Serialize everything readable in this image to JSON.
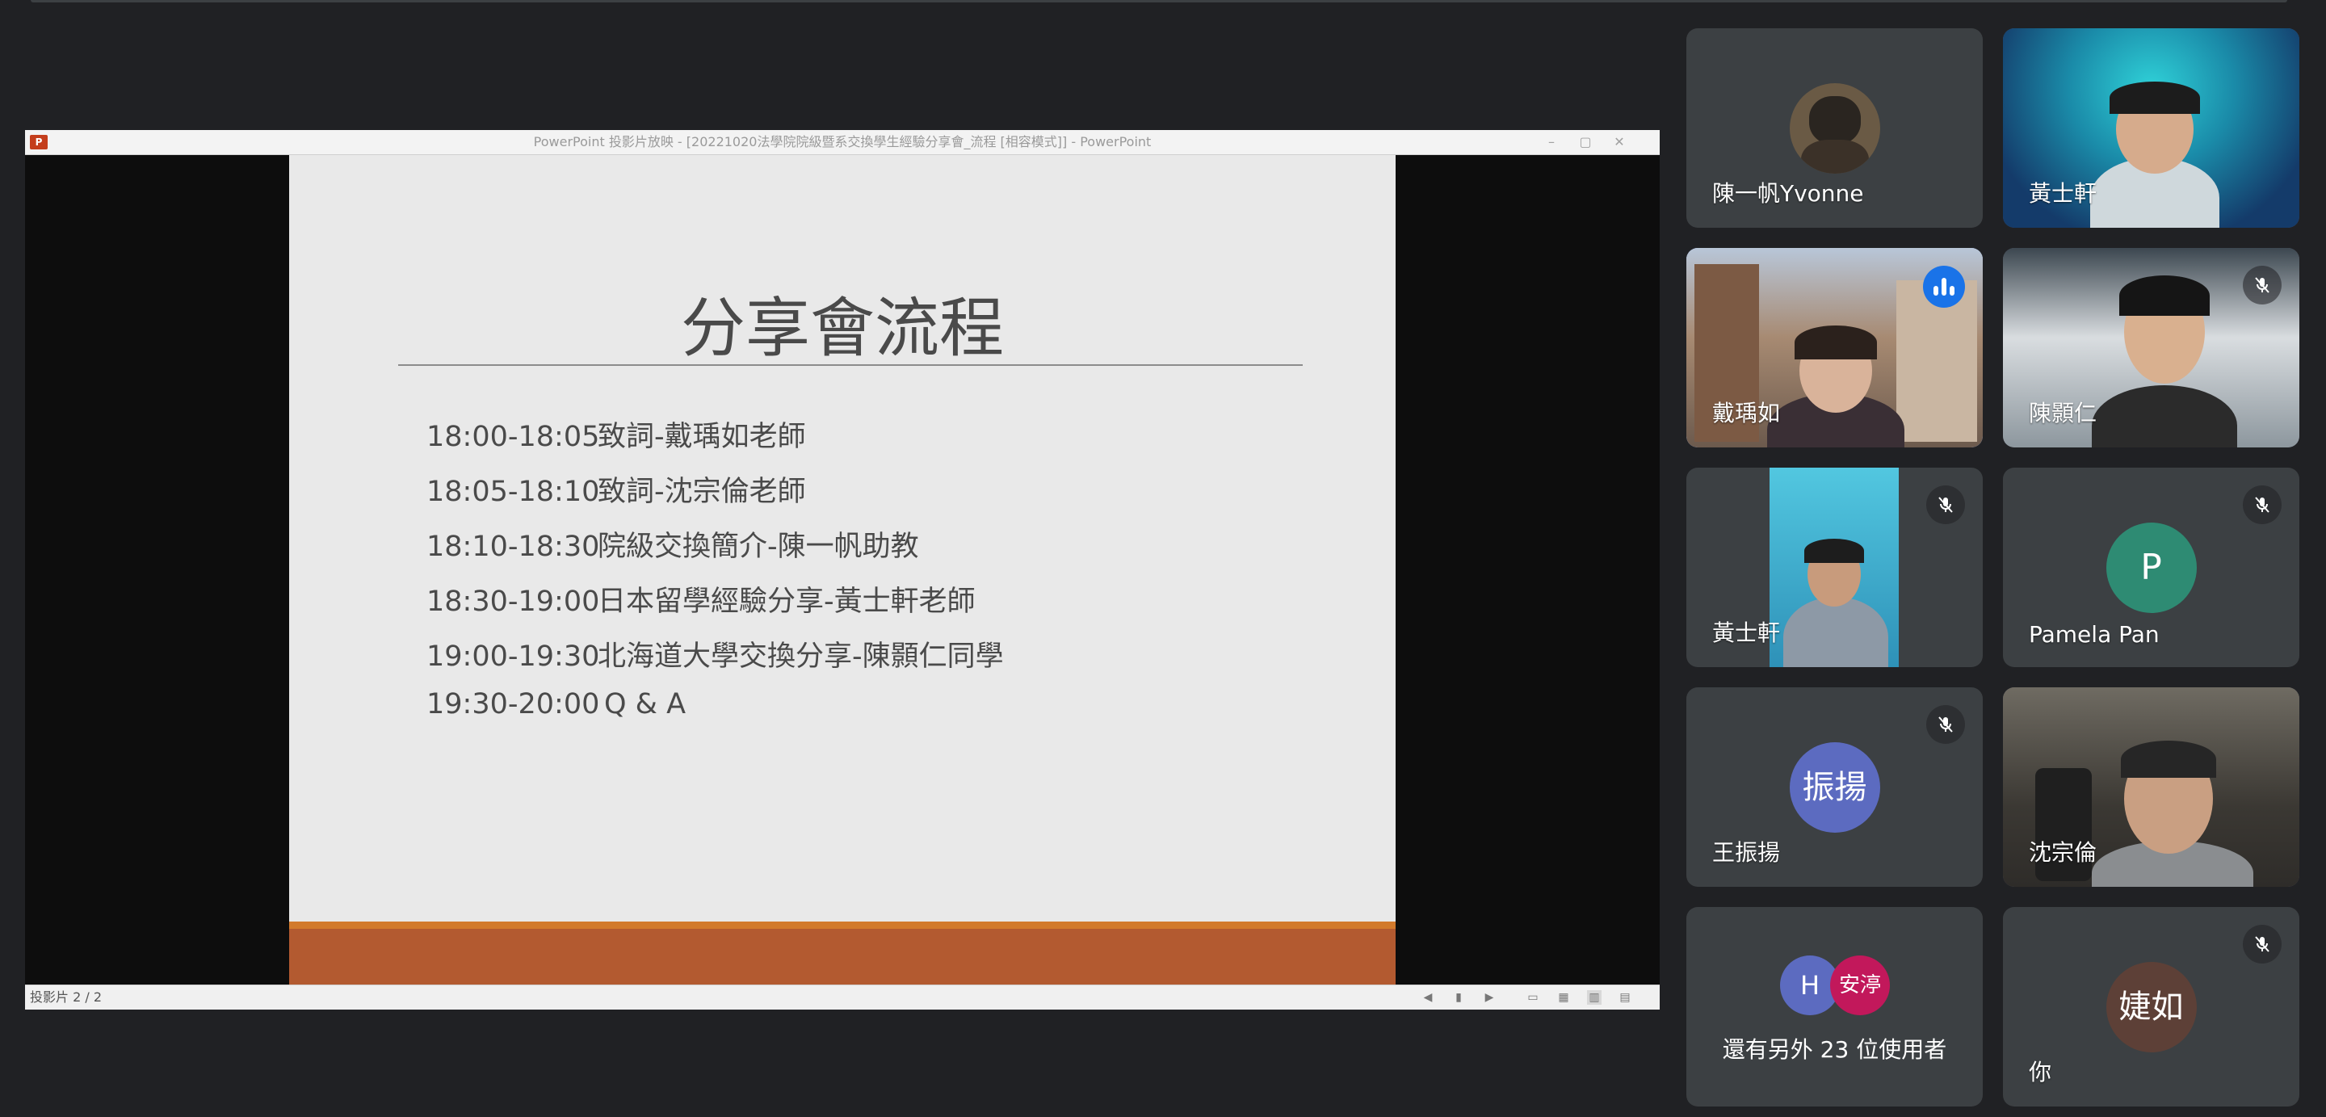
{
  "presentation": {
    "window_title": "PowerPoint 投影片放映 - [20221020法學院院級暨系交換學生經驗分享會_流程 [相容模式]] - PowerPoint",
    "slide_number": "投影片 2 / 2",
    "slide": {
      "title": "分享會流程",
      "agenda": [
        {
          "time": "18:00-18:05",
          "item": "致詞-戴瑀如老師"
        },
        {
          "time": "18:05-18:10",
          "item": "致詞-沈宗倫老師"
        },
        {
          "time": "18:10-18:30",
          "item": "院級交換簡介-陳一帆助教"
        },
        {
          "time": "18:30-19:00",
          "item": "日本留學經驗分享-黃士軒老師"
        },
        {
          "time": "19:00-19:30",
          "item": "北海道大學交換分享-陳顥仁同學"
        },
        {
          "time": "19:30-20:00",
          "item": "Q & A"
        }
      ]
    }
  },
  "participants": [
    {
      "name": "陳一帆Yvonne"
    },
    {
      "name": "黃士軒"
    },
    {
      "name": "戴瑀如"
    },
    {
      "name": "陳顥仁"
    },
    {
      "name": "黃士軒"
    },
    {
      "name": "Pamela Pan",
      "initial": "P"
    },
    {
      "name": "王振揚",
      "initial": "振揚"
    },
    {
      "name": "沈宗倫"
    },
    {
      "name": "你",
      "initial": "婕如"
    }
  ],
  "more": {
    "text": "還有另外 23 位使用者",
    "avatars": [
      "H",
      "安渟"
    ]
  },
  "colors": {
    "background": "#202124",
    "tile": "#3c4043",
    "speaking_border": "#8ab4f8",
    "avatar_pamela": "#2e8b73",
    "avatar_wang": "#5c6bc0",
    "avatar_you": "#5d4037",
    "avatar_h": "#5c6bc0",
    "avatar_an": "#c2185b"
  }
}
